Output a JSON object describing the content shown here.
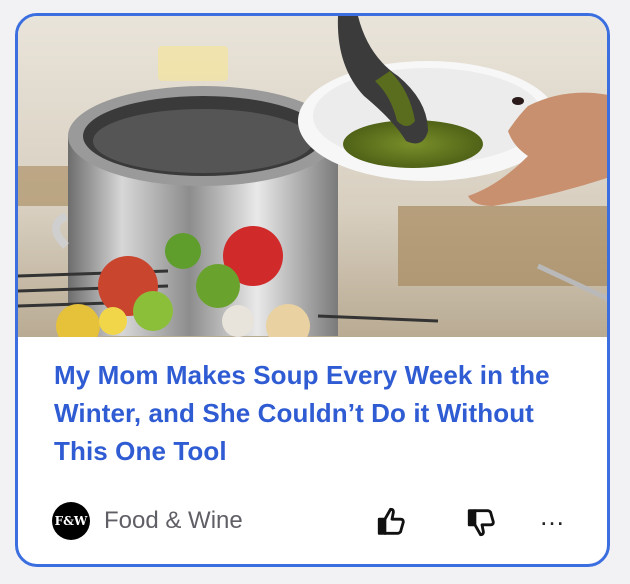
{
  "article": {
    "title": "My Mom Makes Soup Every Week in the Winter, and She Couldn’t Do it Without This One Tool",
    "image_icon": "soup-pot-photo"
  },
  "source": {
    "logo_text": "F&W",
    "name": "Food & Wine"
  },
  "actions": {
    "like_icon": "thumbs-up-icon",
    "dislike_icon": "thumbs-down-icon",
    "more_label": "…"
  },
  "colors": {
    "accent": "#3b6fe0",
    "title": "#2f5bd3",
    "source_text": "#5f5f66"
  }
}
